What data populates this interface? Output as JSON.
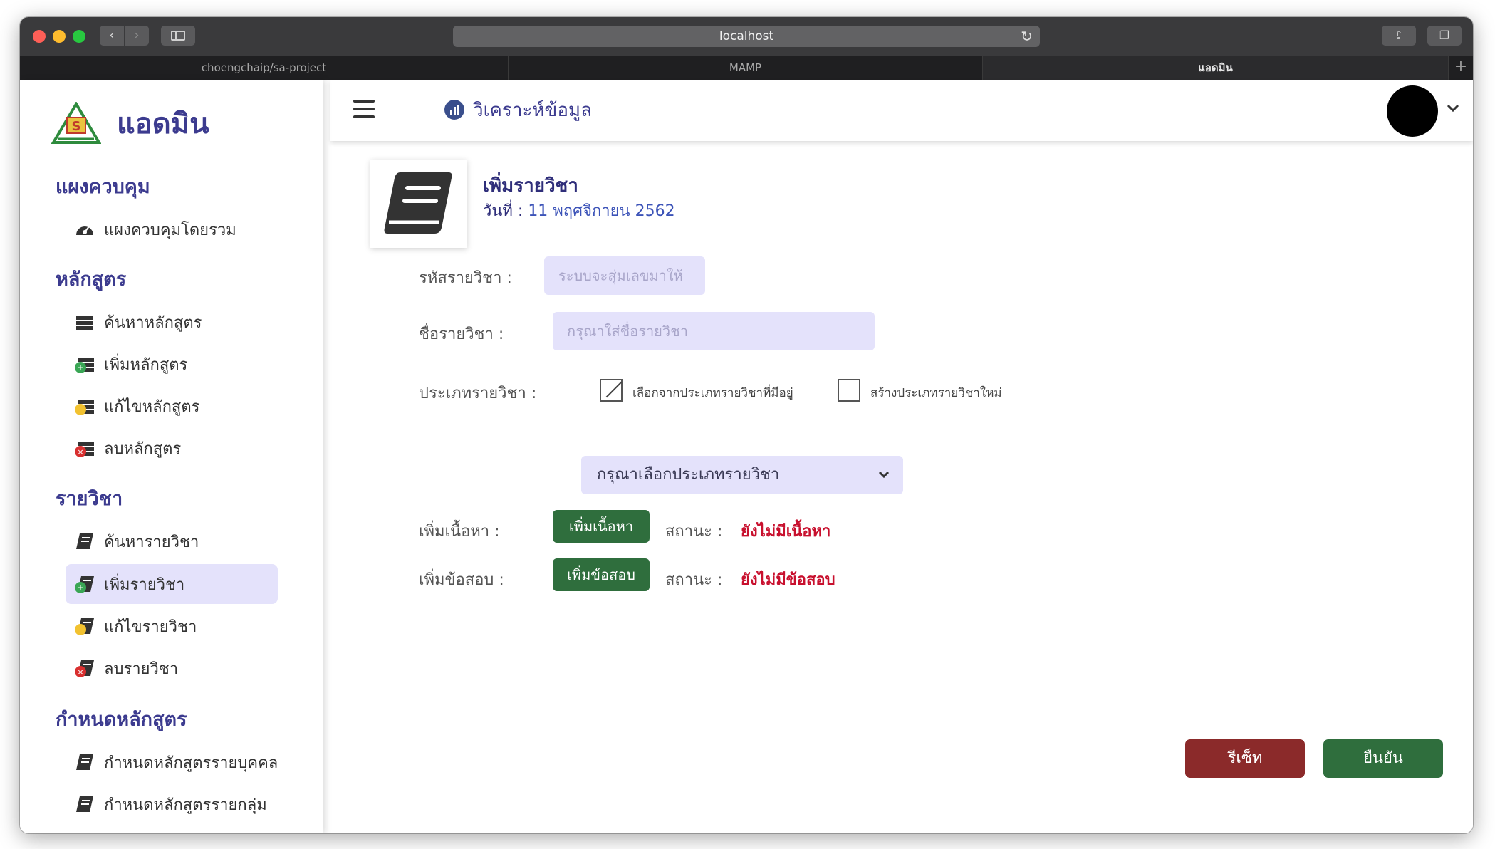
{
  "browser": {
    "url": "localhost",
    "tabs": [
      {
        "label": "choengchaip/sa-project",
        "active": false
      },
      {
        "label": "MAMP",
        "active": false
      },
      {
        "label": "แอดมิน",
        "active": true
      }
    ]
  },
  "sidebar": {
    "brand": "แอดมิน",
    "sections": {
      "dashboard": {
        "title": "แผงควบคุม",
        "items": [
          "แผงควบคุมโดยรวม"
        ]
      },
      "courses": {
        "title": "หลักสูตร",
        "items": [
          "ค้นหาหลักสูตร",
          "เพิ่มหลักสูตร",
          "แก้ไขหลักสูตร",
          "ลบหลักสูตร"
        ]
      },
      "subjects": {
        "title": "รายวิชา",
        "items": [
          "ค้นหารายวิชา",
          "เพิ่มรายวิชา",
          "แก้ไขรายวิชา",
          "ลบรายวิชา"
        ]
      },
      "assign": {
        "title": "กำหนดหลักสูตร",
        "items": [
          "กำหนดหลักสูตรรายบุคคล",
          "กำหนดหลักสูตรรายกลุ่ม"
        ]
      }
    },
    "active_item": "เพิ่มรายวิชา"
  },
  "topbar": {
    "title": "วิเคราะห์ข้อมูล"
  },
  "page": {
    "title": "เพิ่มรายวิชา",
    "date_label": "วันที่ :",
    "date_value": "11 พฤศจิกายน 2562"
  },
  "form": {
    "code_label": "รหัสรายวิชา :",
    "code_placeholder": "ระบบจะสุ่มเลขมาให้",
    "name_label": "ชื่อรายวิชา :",
    "name_placeholder": "กรุณาใส่ชื่อรายวิชา",
    "type_label": "ประเภทรายวิชา :",
    "type_existing_label": "เลือกจากประเภทรายวิชาที่มีอยู่",
    "type_existing_checked": true,
    "type_new_label": "สร้างประเภทรายวิชาใหม่",
    "type_new_checked": false,
    "type_select_value": "กรุณาเลือกประเภทรายวิชา",
    "content_label": "เพิ่มเนื้อหา :",
    "content_button": "เพิ่มเนื้อหา",
    "content_status_label": "สถานะ :",
    "content_status_value": "ยังไม่มีเนื้อหา",
    "exam_label": "เพิ่มข้อสอบ :",
    "exam_button": "เพิ่มข้อสอบ",
    "exam_status_label": "สถานะ :",
    "exam_status_value": "ยังไม่มีข้อสอบ"
  },
  "actions": {
    "reset": "รีเซ็ท",
    "confirm": "ยืนยัน"
  },
  "colors": {
    "brand": "#3c3b8f",
    "input_bg": "#e4e2fb",
    "green": "#2f6e3d",
    "red_button": "#8b2a2a",
    "status_red": "#c8102e"
  }
}
